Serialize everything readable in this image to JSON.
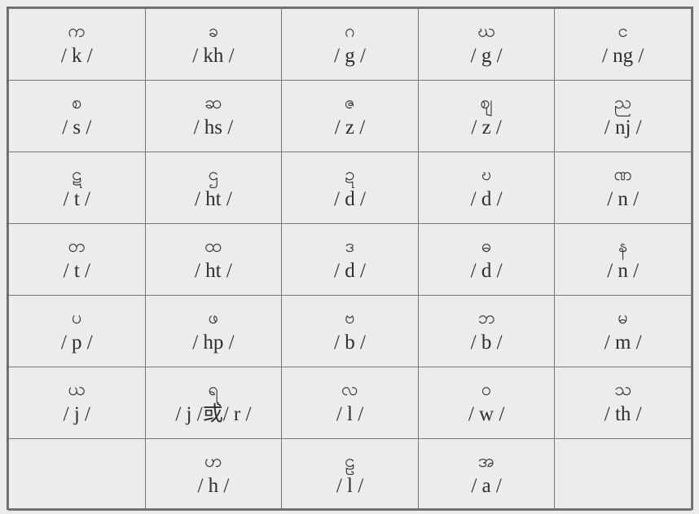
{
  "rows": [
    [
      {
        "letter": "က",
        "sound": "/ k /"
      },
      {
        "letter": "ခ",
        "sound": "/ kh /"
      },
      {
        "letter": "ဂ",
        "sound": "/ g /"
      },
      {
        "letter": "ဃ",
        "sound": "/ g /"
      },
      {
        "letter": "င",
        "sound": "/ ng /"
      }
    ],
    [
      {
        "letter": "စ",
        "sound": "/ s /"
      },
      {
        "letter": "ဆ",
        "sound": "/ hs /"
      },
      {
        "letter": "ဇ",
        "sound": "/ z /"
      },
      {
        "letter": "ဈ",
        "sound": "/ z /"
      },
      {
        "letter": "ည",
        "sound": "/ nj /"
      }
    ],
    [
      {
        "letter": "ဋ",
        "sound": "/ t /"
      },
      {
        "letter": "ဌ",
        "sound": "/ ht /"
      },
      {
        "letter": "ဍ",
        "sound": "/ d /"
      },
      {
        "letter": "ဎ",
        "sound": "/ d /"
      },
      {
        "letter": "ဏ",
        "sound": "/ n /"
      }
    ],
    [
      {
        "letter": "တ",
        "sound": "/ t /"
      },
      {
        "letter": "ထ",
        "sound": "/ ht /"
      },
      {
        "letter": "ဒ",
        "sound": "/ d /"
      },
      {
        "letter": "ဓ",
        "sound": "/ d /"
      },
      {
        "letter": "န",
        "sound": "/ n /"
      }
    ],
    [
      {
        "letter": "ပ",
        "sound": "/ p /"
      },
      {
        "letter": "ဖ",
        "sound": "/ hp /"
      },
      {
        "letter": "ဗ",
        "sound": "/ b /"
      },
      {
        "letter": "ဘ",
        "sound": "/ b /"
      },
      {
        "letter": "မ",
        "sound": "/ m /"
      }
    ],
    [
      {
        "letter": "ယ",
        "sound": "/ j /"
      },
      {
        "letter": "ရ",
        "sound": "/ j /或/ r /"
      },
      {
        "letter": "လ",
        "sound": "/ l /"
      },
      {
        "letter": "ဝ",
        "sound": "/ w /"
      },
      {
        "letter": "သ",
        "sound": "/ th /"
      }
    ],
    [
      {
        "letter": "",
        "sound": ""
      },
      {
        "letter": "ဟ",
        "sound": "/ h /"
      },
      {
        "letter": "ဠ",
        "sound": "/ l /"
      },
      {
        "letter": "အ",
        "sound": "/ a /"
      },
      {
        "letter": "",
        "sound": ""
      }
    ]
  ]
}
